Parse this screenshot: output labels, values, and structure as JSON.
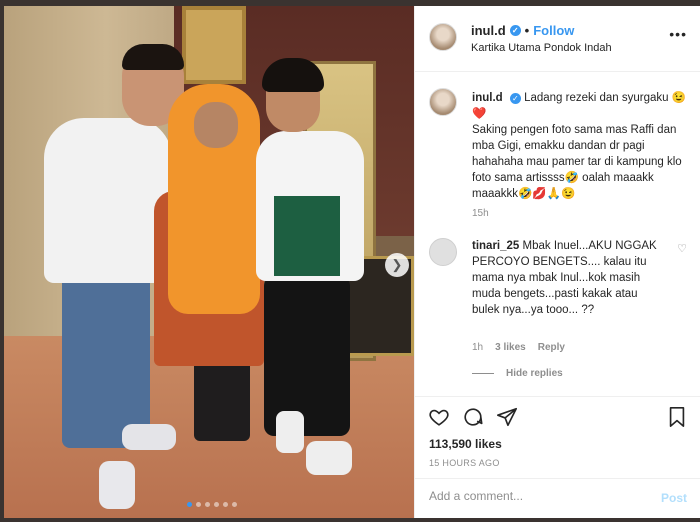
{
  "post": {
    "username": "inul.d",
    "follow_label": "Follow",
    "separator": "•",
    "location": "Kartika Utama Pondok Indah",
    "more_label": "•••"
  },
  "caption": {
    "username": "inul.d",
    "line1": "Ladang rezeki dan syurgaku",
    "line1_emoji": "😉❤️",
    "body": "Saking pengen foto sama mas Raffi dan mba Gigi, emakku dandan dr pagi hahahaha mau pamer tar di kampung klo foto sama artissss🤣 oalah maaakk maaakkk🤣💋🙏😉",
    "time": "15h"
  },
  "comment": {
    "username": "tinari_25",
    "text": "Mbak Inuel...AKU NGGAK PERCOYO BENGETS.... kalau itu mama nya mbak Inul...kok masih muda bengets...pasti kakak atau bulek nya...ya tooo... ??",
    "time": "1h",
    "likes": "3 likes",
    "reply": "Reply",
    "hide_replies": "Hide replies"
  },
  "actions": {
    "likes": "113,590 likes",
    "posted": "15 HOURS AGO"
  },
  "add_comment": {
    "placeholder": "Add a comment...",
    "post_label": "Post"
  },
  "colors": {
    "accent": "#3897f0",
    "muted": "#8e8e8e",
    "text": "#262626",
    "post_disabled": "#b2dffc"
  },
  "carousel": {
    "slides": 6,
    "active_index": 0
  }
}
